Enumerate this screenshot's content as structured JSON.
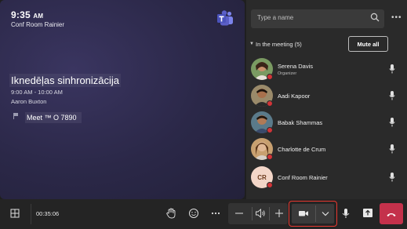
{
  "room": {
    "time": "9:35",
    "ampm": "AM",
    "name": "Conf Room Rainier"
  },
  "meeting": {
    "title": "Iknedēļas sinhronizācija",
    "time_range": "9:00 AM - 10:00 AM",
    "organizer": "Aaron Buxton",
    "meeting_id": "Meet ™ O 7890"
  },
  "roster": {
    "search_placeholder": "Type a name",
    "section_label": "In the meeting (5)",
    "mute_all_label": "Mute all",
    "participants": [
      {
        "name": "Serena Davis",
        "role": "Organizer",
        "avatar": "photo"
      },
      {
        "name": "Aadi Kapoor",
        "role": "",
        "avatar": "photo"
      },
      {
        "name": "Babak Shammas",
        "role": "",
        "avatar": "photo"
      },
      {
        "name": "Charlotte de Crum",
        "role": "",
        "avatar": "photo"
      },
      {
        "name": "Conf Room Rainier",
        "role": "",
        "avatar": "CR"
      }
    ]
  },
  "toolbar": {
    "duration": "00:35:06"
  },
  "icons": {
    "grid": "grid-icon",
    "raise_hand": "raise-hand-icon",
    "reactions": "smiley-icon",
    "more": "more-icon",
    "volume_down": "minus-icon",
    "volume": "speaker-icon",
    "volume_up": "plus-icon",
    "camera": "camera-icon",
    "camera_options": "chevron-down-icon",
    "mic": "microphone-icon",
    "share": "share-icon",
    "hangup": "hang-up-icon"
  },
  "colors": {
    "hangup": "#c4314b",
    "status_busy": "#d13438",
    "highlight_border": "#e8382f",
    "teams_purple": "#5b5fc7"
  }
}
